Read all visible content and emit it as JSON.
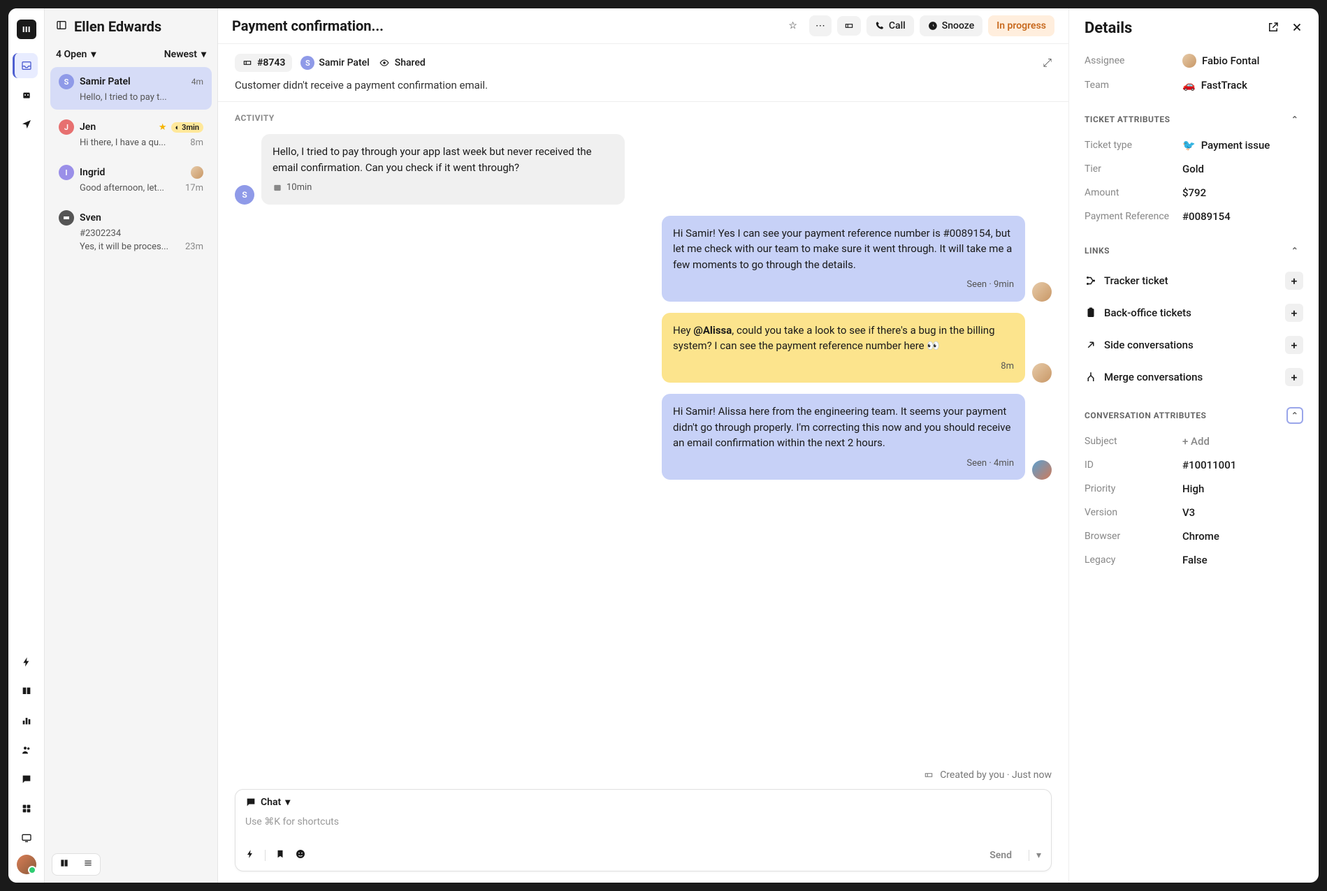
{
  "inbox": {
    "title": "Ellen Edwards",
    "filter": "4 Open",
    "sort": "Newest",
    "items": [
      {
        "name": "Samir Patel",
        "preview": "Hello, I tried to pay t...",
        "time": "4m",
        "avatar_bg": "#8f9ae8",
        "initial": "S",
        "active": true
      },
      {
        "name": "Jen",
        "preview": "Hi there, I have a qu...",
        "time": "8m",
        "avatar_bg": "#e77070",
        "initial": "J",
        "sla": "3min",
        "star": true
      },
      {
        "name": "Ingrid",
        "preview": "Good afternoon, let...",
        "time": "17m",
        "avatar_bg": "#9a8fe8",
        "initial": "I",
        "assignee_dot": true
      },
      {
        "name": "Sven",
        "sub": "#2302234",
        "preview": "Yes, it will be proces...",
        "time": "23m",
        "ticket_icon": true
      }
    ]
  },
  "conversation": {
    "title": "Payment confirmation...",
    "buttons": {
      "call": "Call",
      "snooze": "Snooze",
      "status": "In progress"
    },
    "ticket_id": "#8743",
    "person": "Samir Patel",
    "shared": "Shared",
    "description": "Customer didn't receive a payment confirmation email.",
    "activity_label": "ACTIVITY",
    "messages": [
      {
        "side": "left",
        "style": "gray",
        "text": "Hello, I tried to pay through your app last week but never received the email confirmation. Can you check if it went through?",
        "meta": "10min",
        "avatar_bg": "#8f9ae8",
        "initial": "S"
      },
      {
        "side": "right",
        "style": "blue",
        "text": "Hi Samir! Yes I can see your payment reference number is #0089154, but let me check with our team to make sure it went through. It will take me a few moments to go through the details.",
        "meta": "Seen · 9min"
      },
      {
        "side": "right",
        "style": "yellow",
        "text_pre": "Hey ",
        "mention": "@Alissa",
        "text_post": ", could you take a look to see if there's a bug in the billing system? I can see the payment reference number here 👀",
        "meta": "8m"
      },
      {
        "side": "right",
        "style": "blue",
        "text": "Hi Samir! Alissa here from the engineering team. It seems your payment didn't go through properly. I'm correcting this now and you should receive an email confirmation within the next 2 hours.",
        "meta": "Seen · 4min",
        "alt_avatar": true
      }
    ],
    "created": "Created by you · Just now",
    "composer": {
      "mode": "Chat",
      "placeholder": "Use ⌘K for shortcuts",
      "send": "Send"
    }
  },
  "details": {
    "title": "Details",
    "assignee_label": "Assignee",
    "assignee": "Fabio Fontal",
    "team_label": "Team",
    "team": "FastTrack",
    "ticket_attributes_label": "TICKET ATTRIBUTES",
    "ticket_attrs": [
      {
        "label": "Ticket type",
        "value": "Payment issue",
        "emoji": "🐦"
      },
      {
        "label": "Tier",
        "value": "Gold"
      },
      {
        "label": "Amount",
        "value": "$792"
      },
      {
        "label": "Payment Reference",
        "value": "#0089154"
      }
    ],
    "links_label": "LINKS",
    "links": [
      {
        "label": "Tracker ticket",
        "icon": "tracker"
      },
      {
        "label": "Back-office tickets",
        "icon": "clipboard"
      },
      {
        "label": "Side conversations",
        "icon": "arrow"
      },
      {
        "label": "Merge conversations",
        "icon": "merge"
      }
    ],
    "conv_attributes_label": "CONVERSATION ATTRIBUTES",
    "conv_attrs": [
      {
        "label": "Subject",
        "value": "+ Add"
      },
      {
        "label": "ID",
        "value": "#10011001"
      },
      {
        "label": "Priority",
        "value": "High"
      },
      {
        "label": "Version",
        "value": "V3"
      },
      {
        "label": "Browser",
        "value": "Chrome"
      },
      {
        "label": "Legacy",
        "value": "False"
      }
    ]
  }
}
